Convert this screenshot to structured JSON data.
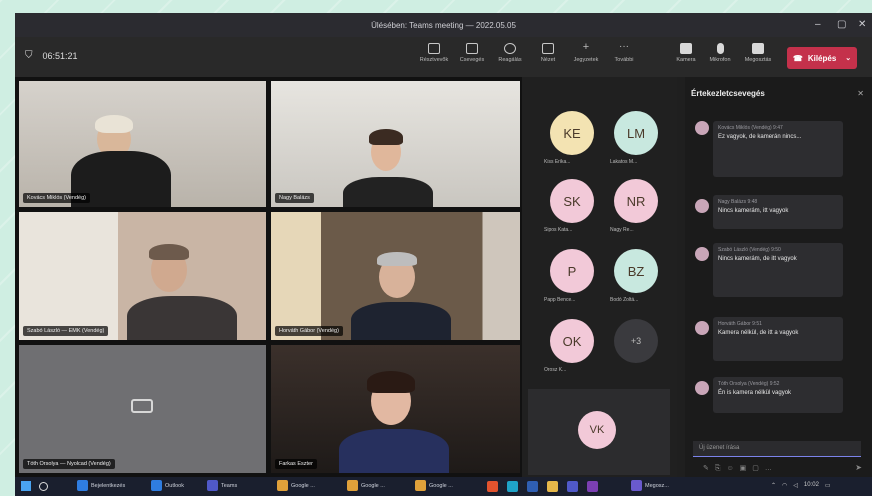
{
  "window": {
    "title": "Ülésében: Teams meeting — 2022.05.05"
  },
  "toolbar": {
    "timer": "06:51:21",
    "buttons": [
      "Résztvevők",
      "Csevegés",
      "Reagálás",
      "Nézet",
      "Jegyzetek",
      "További",
      "Kamera",
      "Mikrofon",
      "Megosztás"
    ],
    "leave_label": "Kilépés"
  },
  "tiles": [
    {
      "name": "Kovács Miklós (Vendég)"
    },
    {
      "name": "Nagy Balázs"
    },
    {
      "name": "Szabó László — EMK (Vendég)"
    },
    {
      "name": "Horváth Gábor (Vendég)"
    },
    {
      "name": "Tóth Orsolya — Nyolcad (Vendég)"
    },
    {
      "name": "Farkas Eszter"
    }
  ],
  "roster": [
    {
      "initials": "KE",
      "label": "Kiss Erika...",
      "color": "#f3e3b2"
    },
    {
      "initials": "LM",
      "label": "Lakatos M...",
      "color": "#c8e8df"
    },
    {
      "initials": "SK",
      "label": "Sipos Kata...",
      "color": "#f2c9d8"
    },
    {
      "initials": "NR",
      "label": "Nagy Re...",
      "color": "#f2c9d8"
    },
    {
      "initials": "P",
      "label": "Papp Bence...",
      "color": "#f2c9d8"
    },
    {
      "initials": "BZ",
      "label": "Bodó Zoltá...",
      "color": "#c8e8df"
    },
    {
      "initials": "OK",
      "label": "Orosz K...",
      "color": "#f2c9d8"
    },
    {
      "initials": "+3",
      "label": "",
      "color": "#3a3a3e"
    },
    {
      "initials": "VK",
      "label": "",
      "color": "#f2c9d8"
    }
  ],
  "chat": {
    "title": "Értekezletcsevegés",
    "messages": [
      {
        "who": "Kovács Miklós (Vendég)  9:47",
        "text": "Ez vagyok, de kamerán nincs..."
      },
      {
        "who": "Nagy Balázs  9:48",
        "text": "Nincs kamerám, itt vagyok"
      },
      {
        "who": "Szabó László (Vendég)  9:50",
        "text": "Nincs kamerám, de itt vagyok"
      },
      {
        "who": "Horváth Gábor  9:51",
        "text": "Kamera nélkül, de itt a vagyok"
      },
      {
        "who": "Tóth Orsolya (Vendég)  9:52",
        "text": "Én is kamera nélkül vagyok"
      }
    ],
    "compose_placeholder": "Új üzenet írása"
  },
  "taskbar": [
    {
      "label": "Bejelentkezés",
      "color": "#2f7de1"
    },
    {
      "label": "Outlook",
      "color": "#2f7de1"
    },
    {
      "label": "Teams",
      "color": "#5059c9"
    },
    {
      "label": "Google ...",
      "color": "#e0a13a"
    },
    {
      "label": "Google ...",
      "color": "#e0a13a"
    },
    {
      "label": "Google ...",
      "color": "#e0a13a"
    },
    {
      "label": "Megosz...",
      "color": "#6a5acd"
    }
  ],
  "clock": "10:02"
}
